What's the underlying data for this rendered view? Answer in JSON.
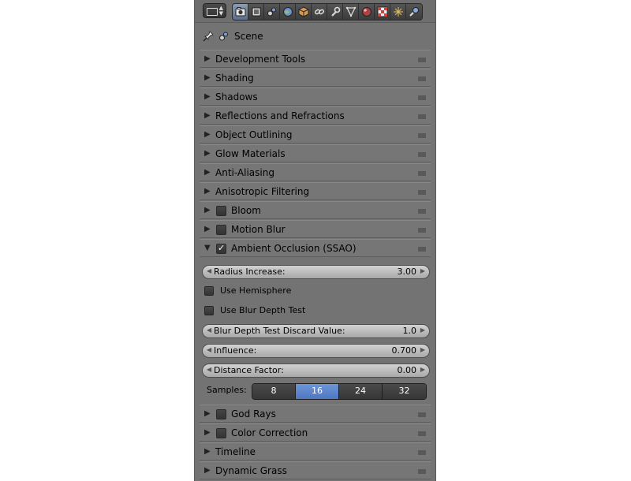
{
  "header": {
    "editor_icon": "properties-editor-icon",
    "tabs": [
      {
        "icon": "render-icon",
        "active": true
      },
      {
        "icon": "render-layers-icon"
      },
      {
        "icon": "scene-icon"
      },
      {
        "icon": "world-icon"
      },
      {
        "icon": "object-icon"
      },
      {
        "icon": "constraints-icon"
      },
      {
        "icon": "modifiers-icon"
      },
      {
        "icon": "data-icon"
      },
      {
        "icon": "material-icon"
      },
      {
        "icon": "texture-icon"
      },
      {
        "icon": "particles-icon"
      },
      {
        "icon": "physics-icon"
      }
    ]
  },
  "context": {
    "pin_icon": "pin-icon",
    "scene_icon": "scene-icon",
    "label": "Scene"
  },
  "panels_top": [
    {
      "label": "Development Tools",
      "expanded": false
    },
    {
      "label": "Shading",
      "expanded": false
    },
    {
      "label": "Shadows",
      "expanded": false
    },
    {
      "label": "Reflections and Refractions",
      "expanded": false
    },
    {
      "label": "Object Outlining",
      "expanded": false
    },
    {
      "label": "Glow Materials",
      "expanded": false
    },
    {
      "label": "Anti-Aliasing",
      "expanded": false
    },
    {
      "label": "Anisotropic Filtering",
      "expanded": false
    },
    {
      "label": "Bloom",
      "expanded": false,
      "checkbox": true,
      "checked": false
    },
    {
      "label": "Motion Blur",
      "expanded": false,
      "checkbox": true,
      "checked": false
    }
  ],
  "ssao": {
    "label": "Ambient Occlusion (SSAO)",
    "expanded": true,
    "checked": true,
    "radius": {
      "label": "Radius Increase:",
      "value": "3.00"
    },
    "use_hemisphere": {
      "label": "Use Hemisphere",
      "checked": false
    },
    "use_blur_depth": {
      "label": "Use Blur Depth Test",
      "checked": false
    },
    "blur_discard": {
      "label": "Blur Depth Test Discard Value:",
      "value": "1.0"
    },
    "influence": {
      "label": "Influence:",
      "value": "0.700"
    },
    "distance": {
      "label": "Distance Factor:",
      "value": "0.00"
    },
    "samples": {
      "label": "Samples:",
      "options": [
        "8",
        "16",
        "24",
        "32"
      ],
      "selected": "16"
    }
  },
  "panels_bottom": [
    {
      "label": "God Rays",
      "expanded": false,
      "checkbox": true,
      "checked": false
    },
    {
      "label": "Color Correction",
      "expanded": false,
      "checkbox": true,
      "checked": false
    },
    {
      "label": "Timeline",
      "expanded": false
    },
    {
      "label": "Dynamic Grass",
      "expanded": false
    }
  ]
}
